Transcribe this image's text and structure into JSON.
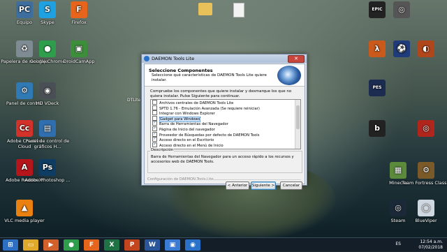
{
  "desktop": {
    "icons": [
      {
        "id": "equipo",
        "label": "Equipo",
        "glyph": "PC",
        "color": "#3d6e9e"
      },
      {
        "id": "skype",
        "label": "Skype",
        "glyph": "S",
        "color": "#1fa0e0"
      },
      {
        "id": "firefox",
        "label": "Firefox",
        "glyph": "F",
        "color": "#e7641c"
      },
      {
        "id": "papelera",
        "label": "Papelera de reciclaje",
        "glyph": "♻",
        "color": "#7f8b93"
      },
      {
        "id": "chrome",
        "label": "Google Chrome",
        "glyph": "●",
        "color": "#2f9e4c"
      },
      {
        "id": "droidcam",
        "label": "DroidCamApp",
        "glyph": "▣",
        "color": "#3c8e3b"
      },
      {
        "id": "panel",
        "label": "Panel de control",
        "glyph": "⚙",
        "color": "#2f79b5"
      },
      {
        "id": "hdvdeck",
        "label": "HD VDeck",
        "glyph": "◉",
        "color": "#4a4f55"
      },
      {
        "id": "adobecc",
        "label": "Adobe Creative Cloud",
        "glyph": "Cc",
        "color": "#d3322b"
      },
      {
        "id": "panelgraficos",
        "label": "Panel de control de gráficos H...",
        "glyph": "▤",
        "color": "#2f6fb0"
      },
      {
        "id": "adobereader",
        "label": "Adobe Reader XI",
        "glyph": "A",
        "color": "#b5161c"
      },
      {
        "id": "photoshop",
        "label": "Adobe Photoshop ...",
        "glyph": "Ps",
        "color": "#0e3c62"
      },
      {
        "id": "vlc",
        "label": "VLC media player",
        "glyph": "▲",
        "color": "#e9800f"
      },
      {
        "id": "epic",
        "label": "",
        "glyph": "EPIC",
        "color": "#222222"
      },
      {
        "id": "rust",
        "label": "",
        "glyph": "◎",
        "color": "#555555"
      },
      {
        "id": "halflife",
        "label": "",
        "glyph": "λ",
        "color": "#c95a1c"
      },
      {
        "id": "pes",
        "label": "",
        "glyph": "⚽",
        "color": "#1f3b7a"
      },
      {
        "id": "tf2",
        "label": "",
        "glyph": "◐",
        "color": "#b0461c"
      },
      {
        "id": "pes2",
        "label": "",
        "glyph": "PES",
        "color": "#1c2b50"
      },
      {
        "id": "blackhole",
        "label": "",
        "glyph": "b",
        "color": "#222222"
      },
      {
        "id": "game3",
        "label": "",
        "glyph": "◎",
        "color": "#b1261c"
      },
      {
        "id": "minecraft",
        "label": "Minecra",
        "glyph": "▦",
        "color": "#5a8a3a"
      },
      {
        "id": "teamfortress",
        "label": "Team Fortress Classic",
        "glyph": "⚙",
        "color": "#7b5a2a"
      },
      {
        "id": "steam",
        "label": "Steam",
        "glyph": "◎",
        "color": "#1b2838"
      },
      {
        "id": "blueviper",
        "label": "BlueViper",
        "glyph": "◯",
        "color": "#cfd8e0"
      }
    ],
    "folder_icons": [
      "folder",
      "document"
    ],
    "partial_label": "DTLite"
  },
  "dialog": {
    "title": "DAEMON Tools Lite",
    "close_glyph": "✕",
    "header_title": "Seleccione Componentes",
    "header_sub": "Seleccione qué características de DAEMON Tools Lite quiere instalar.",
    "instructions": "Compruebe los componentes que quiere instalar y desmarque los que no quiera instalar. Pulse Siguiente para continuar.",
    "components": [
      {
        "label": "Archivos centrales de DAEMON Tools Lite",
        "checked": false
      },
      {
        "label": "SPTD 1.76 - Emulación Avanzada (Se requiere reiniciar)",
        "checked": false
      },
      {
        "label": "Integrar con Windows Explorer",
        "checked": false
      },
      {
        "label": "Gadget para Windows",
        "checked": false,
        "highlighted": true
      },
      {
        "label": "Barra de Herramientas del Navegador",
        "checked": true
      },
      {
        "label": "Página de Inicio del navegador",
        "checked": true
      },
      {
        "label": "Proveedor de Búsquedas por defecto de DAEMON Tools",
        "checked": true
      },
      {
        "label": "Acceso directo en el Escritorio",
        "checked": true
      },
      {
        "label": "Acceso directo en el Menú de Inicio",
        "checked": true
      }
    ],
    "description_label": "Descripción",
    "description_text": "Barra de Herramientas del Navegador para un acceso rápido a los recursos y accesorios web de DAEMON Tools.",
    "footer_text": "Configuración de DAEMON Tools Lite",
    "buttons": {
      "back": "< Anterior",
      "next": "Siguiente >",
      "cancel": "Cancelar"
    }
  },
  "taskbar": {
    "apps": [
      "start",
      "explorer",
      "media",
      "chrome",
      "firefox",
      "excel",
      "powerpoint",
      "word",
      "photos",
      "daemon"
    ],
    "language": "ES",
    "time": "12:54 a.m.",
    "date": "07/02/2018"
  }
}
